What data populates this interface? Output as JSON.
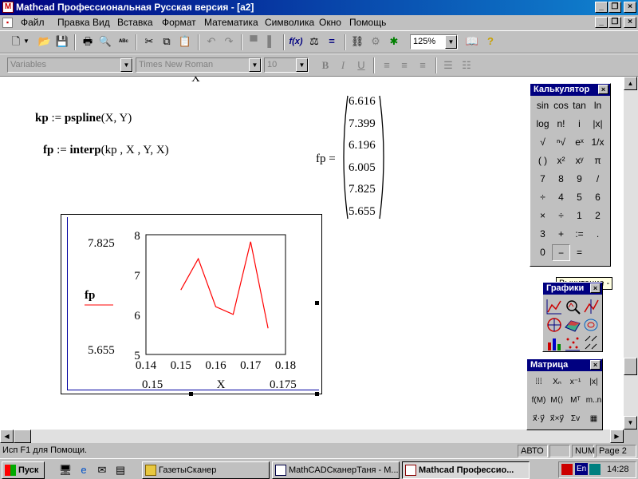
{
  "window": {
    "title": "Mathcad Профессиональная Русская версия - [a2]"
  },
  "menu": [
    "Файл",
    "Правка",
    "Вид",
    "Вставка",
    "Формат",
    "Математика",
    "Символика",
    "Окно",
    "Помощь"
  ],
  "toolbar": {
    "zoom": "125%"
  },
  "format_bar": {
    "style": "Variables",
    "font": "Times New Roman",
    "size": "10",
    "bold": "B",
    "italic": "I",
    "underline": "U"
  },
  "worksheet": {
    "top_x": "X",
    "kp_lhs": "kp",
    "kp_assign": ":=",
    "kp_fn": "pspline",
    "kp_args": "(X, Y)",
    "fp_lhs": "fp",
    "fp_assign": ":=",
    "fp_fn": "interp",
    "fp_args": "(kp , X , Y, X)",
    "result_label": "fp =",
    "result_values": [
      "6.616",
      "7.399",
      "6.196",
      "6.005",
      "7.825",
      "5.655"
    ]
  },
  "chart_data": {
    "type": "line",
    "x": [
      0.15,
      0.155,
      0.16,
      0.165,
      0.17,
      0.175
    ],
    "series": [
      {
        "name": "fp",
        "values": [
          6.616,
          7.399,
          6.196,
          6.005,
          7.825,
          5.655
        ],
        "color": "#ff0000"
      }
    ],
    "xlim": [
      0.14,
      0.18
    ],
    "ylim": [
      5,
      8
    ],
    "x_ticks": [
      "0.14",
      "0.15",
      "0.16",
      "0.17",
      "0.18"
    ],
    "y_ticks": [
      "5",
      "6",
      "7",
      "8"
    ],
    "xlabel": "X",
    "ylabel": "fp",
    "y_max_marker": "7.825",
    "y_min_marker": "5.655",
    "x_min_marker": "0.15",
    "x_max_marker": "0.175"
  },
  "calculator": {
    "title": "Калькулятор",
    "keys": [
      [
        "sin",
        "cos",
        "tan",
        "ln"
      ],
      [
        "log",
        "n!",
        "i",
        "|x|"
      ],
      [
        "√",
        "ⁿ√",
        "eˣ",
        "1/x"
      ],
      [
        "( )",
        "x²",
        "xʸ",
        "π"
      ],
      [
        "7",
        "8",
        "9",
        "/"
      ],
      [
        "÷",
        "4",
        "5",
        "6"
      ],
      [
        "×",
        "÷",
        "1",
        "2"
      ],
      [
        "3",
        "+",
        ":=",
        "."
      ],
      [
        "0",
        "−",
        "=",
        ""
      ]
    ]
  },
  "tooltip": "Вычитание -",
  "graphs_palette": {
    "title": "Графики"
  },
  "matrix_palette": {
    "title": "Матрица",
    "keys": [
      "⁞⁞⁞",
      "Xₙ",
      "x⁻¹",
      "|x|",
      "f(M)",
      "M⟨⟩",
      "Mᵀ",
      "m..n",
      "x⃗·y⃗",
      "x⃗×y⃗",
      "Σv",
      "▦"
    ]
  },
  "status": {
    "help": "Исп F1 для Помощи.",
    "mode": "АВТО",
    "num": "NUM",
    "page": "Page 2"
  },
  "taskbar": {
    "start": "Пуск",
    "tasks": [
      "ГазетыСканер",
      "MathCADСканерТаня - M...",
      "Mathcad Профессио..."
    ],
    "lang": "En",
    "clock": "14:28"
  }
}
